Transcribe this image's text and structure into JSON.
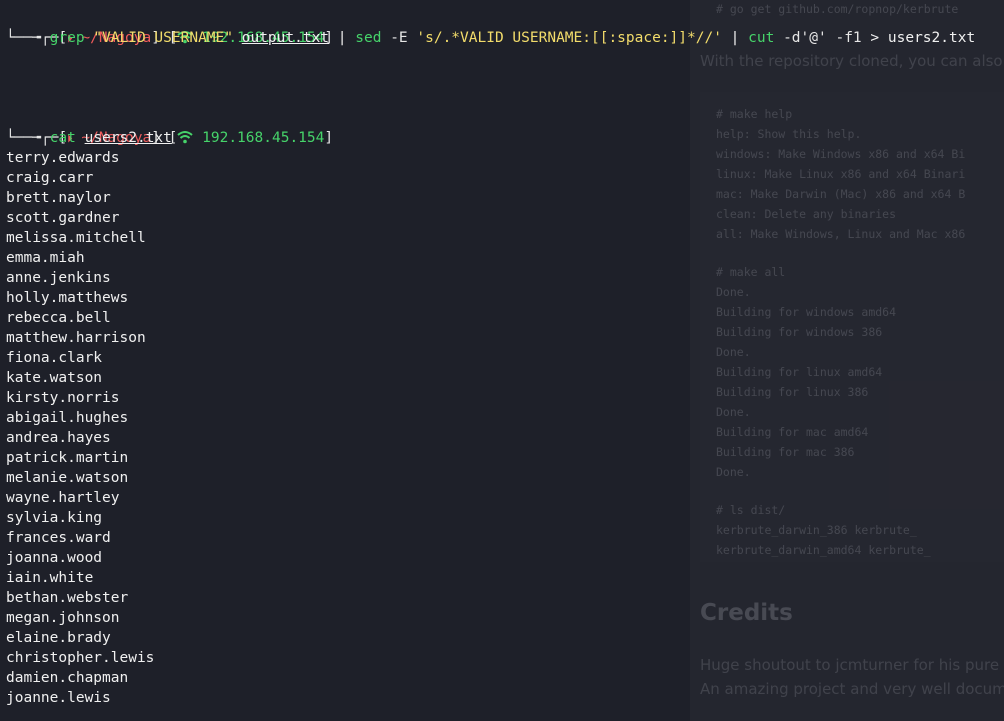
{
  "background_page": {
    "lines": [
      "# go get github.com/ropnop/kerbrute",
      "With the repository cloned, you can also",
      "# make help",
      "help:            Show this help.",
      "windows:  Make Windows x86 and x64 Bi",
      "linux:  Make Linux x86 and x64 Binari",
      "mac:  Make Darwin (Mac) x86 and x64 B",
      "clean:  Delete any binaries",
      "all:  Make Windows, Linux and Mac x86",
      "# make all",
      "Done.",
      "Building for windows amd64",
      "Building for windows 386",
      "Done.",
      "Building for linux amd64",
      "Building for linux 386",
      "Done.",
      "Building for mac amd64",
      "Building for mac 386",
      "Done.",
      "# ls dist/",
      "kerbrute_darwin_386         kerbrute_",
      "kerbrute_darwin_amd64       kerbrute_"
    ],
    "credits_heading": "Credits",
    "credits_text_1": "Huge shoutout to jcmturner for his pure",
    "credits_text_2": "An amazing project and very well docum"
  },
  "prompt": {
    "dir": "~/Nagoya",
    "ip": "192.168.45.154"
  },
  "commands": [
    {
      "cmd1": "grep",
      "arg1": "\"VALID USERNAME\"",
      "file1": "output.txt",
      "pipe1": "|",
      "cmd2": "sed",
      "opt2": "-E",
      "arg2": "'s/.*VALID USERNAME:[[:space:]]*//'",
      "pipe2": "|",
      "cmd3": "cut",
      "opt3a": "-d'@'",
      "opt3b": "-f1",
      "redir": ">",
      "out": "users2.txt"
    },
    {
      "cmd1": "cat",
      "file1": "users2.txt"
    }
  ],
  "output": [
    "terry.edwards",
    "craig.carr",
    "brett.naylor",
    "scott.gardner",
    "melissa.mitchell",
    "emma.miah",
    "anne.jenkins",
    "holly.matthews",
    "rebecca.bell",
    "matthew.harrison",
    "fiona.clark",
    "kate.watson",
    "kirsty.norris",
    "abigail.hughes",
    "andrea.hayes",
    "patrick.martin",
    "melanie.watson",
    "wayne.hartley",
    "sylvia.king",
    "frances.ward",
    "joanna.wood",
    "iain.white",
    "bethan.webster",
    "megan.johnson",
    "elaine.brady",
    "christopher.lewis",
    "damien.chapman",
    "joanne.lewis"
  ],
  "colors": {
    "terminal_bg": "#1e2029",
    "prompt_red": "#ef5b5b",
    "prompt_green": "#46d36a",
    "string_yellow": "#f2dc6b"
  }
}
